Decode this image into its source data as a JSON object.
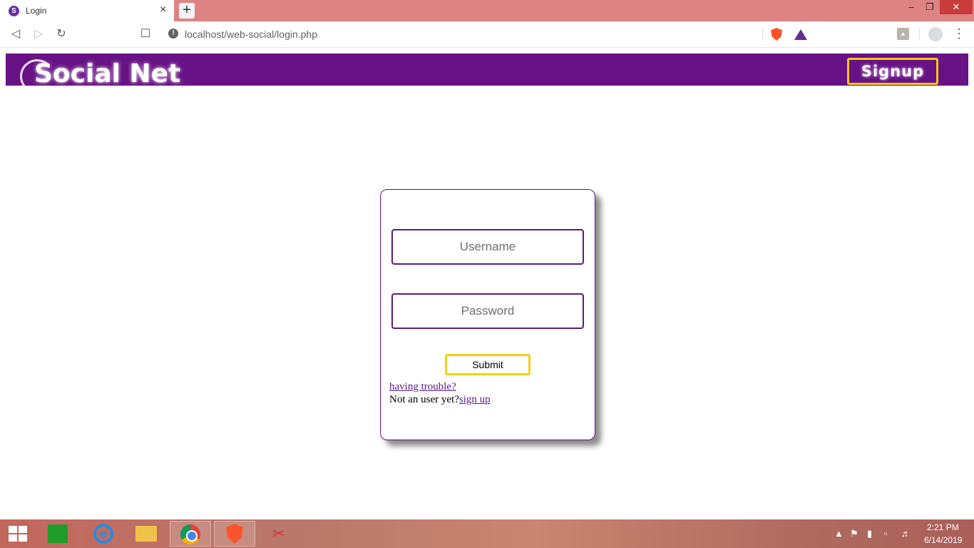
{
  "browser": {
    "tab_title": "Login",
    "tab_favicon_letter": "S",
    "url": "localhost/web-social/login.php",
    "icons": {
      "back": "back-arrow-icon",
      "forward": "forward-arrow-icon",
      "reload": "reload-icon",
      "bookmark": "bookmark-icon",
      "info": "info-icon",
      "brave_shield": "brave-shield-icon",
      "bat": "bat-rewards-icon",
      "pdf": "pdf-extension-icon",
      "profile": "profile-icon",
      "menu": "menu-icon"
    }
  },
  "header": {
    "logo_text": "Social Net",
    "signup_label": "Signup",
    "colors": {
      "background": "#671285",
      "signup_border": "#f5c518"
    }
  },
  "login": {
    "username_placeholder": "Username",
    "password_placeholder": "Password",
    "submit_label": "Submit",
    "trouble_link": "having trouble?",
    "not_user_text": "Not an user yet?",
    "signup_link": "sign up",
    "colors": {
      "border": "#671285",
      "submit_border": "#f5d018",
      "link": "#551a8b"
    }
  },
  "taskbar": {
    "time": "2:21 PM",
    "date": "6/14/2019",
    "apps": [
      "windows-start-icon",
      "store-icon",
      "internet-explorer-icon",
      "file-explorer-icon",
      "chrome-icon",
      "brave-icon",
      "snipping-tool-icon"
    ]
  }
}
